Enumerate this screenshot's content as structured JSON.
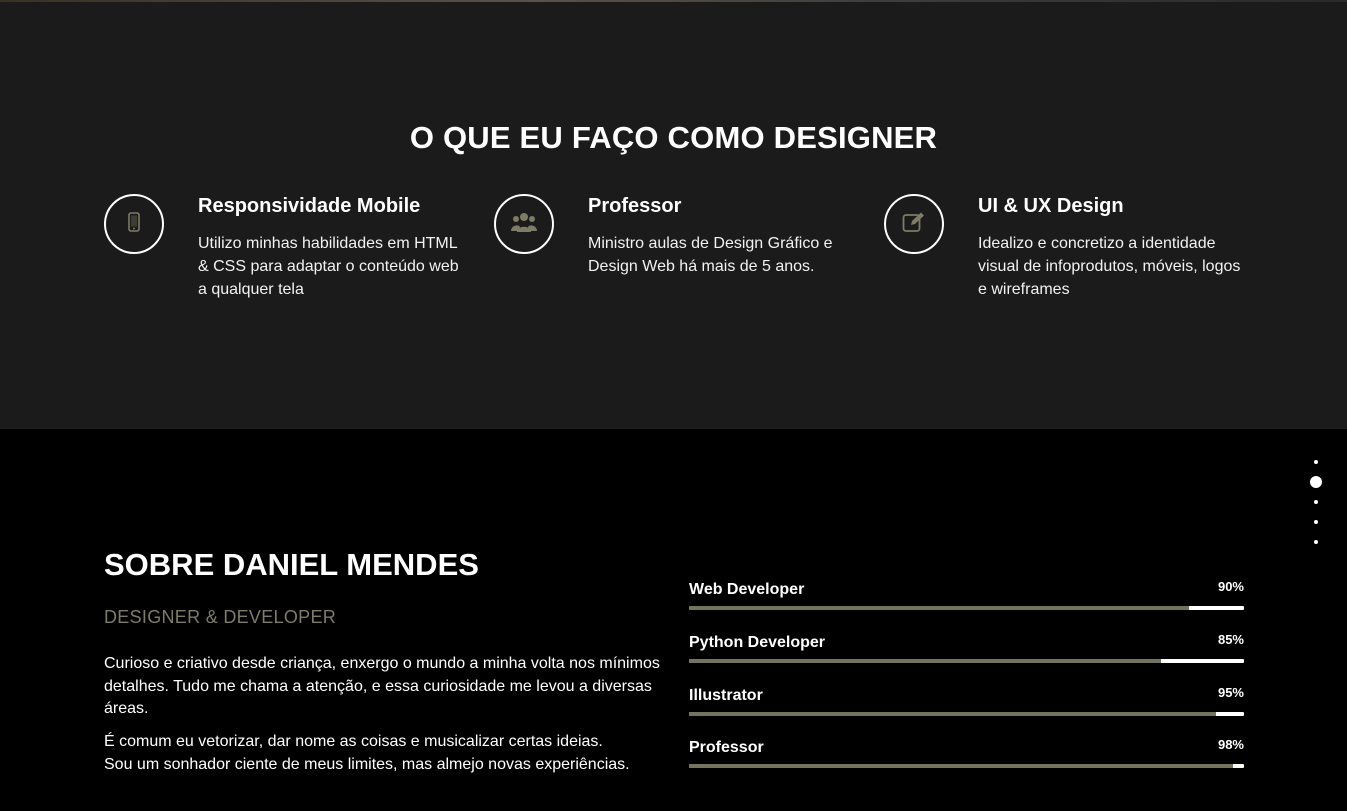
{
  "services": {
    "title": "O QUE EU FAÇO COMO DESIGNER",
    "items": [
      {
        "icon": "mobile-phone-icon",
        "title": "Responsividade Mobile",
        "description": "Utilizo minhas habilidades em HTML & CSS para adaptar o conteúdo web a qualquer tela"
      },
      {
        "icon": "users-group-icon",
        "title": "Professor",
        "description": "Ministro aulas de Design Gráfico e Design Web há mais de 5 anos."
      },
      {
        "icon": "edit-pencil-icon",
        "title": "UI & UX Design",
        "description": "Idealizo e concretizo a identidade visual de infoprodutos, móveis, logos e wireframes"
      }
    ]
  },
  "about": {
    "title": "SOBRE DANIEL MENDES",
    "subtitle": "DESIGNER & DEVELOPER",
    "paragraph1": "Curioso e criativo desde criança, enxergo o mundo a minha volta nos mínimos detalhes. Tudo me chama a atenção, e essa curiosidade me levou a diversas áreas.",
    "paragraph2_line1": "É comum eu vetorizar, dar nome as coisas e musicalizar certas ideias.",
    "paragraph2_line2": "Sou um sonhador ciente de meus limites, mas almejo novas experiências."
  },
  "skills": [
    {
      "name": "Web Developer",
      "percent_label": "90%",
      "percent": 90
    },
    {
      "name": "Python Developer",
      "percent_label": "85%",
      "percent": 85
    },
    {
      "name": "Illustrator",
      "percent_label": "95%",
      "percent": 95
    },
    {
      "name": "Professor",
      "percent_label": "98%",
      "percent": 98
    }
  ],
  "nav_dots": {
    "count": 5,
    "active_index": 1
  },
  "colors": {
    "services_bg": "#1b1b1b",
    "about_bg": "#000000",
    "accent_olive": "#74735d",
    "subtitle": "#7d7c66"
  }
}
